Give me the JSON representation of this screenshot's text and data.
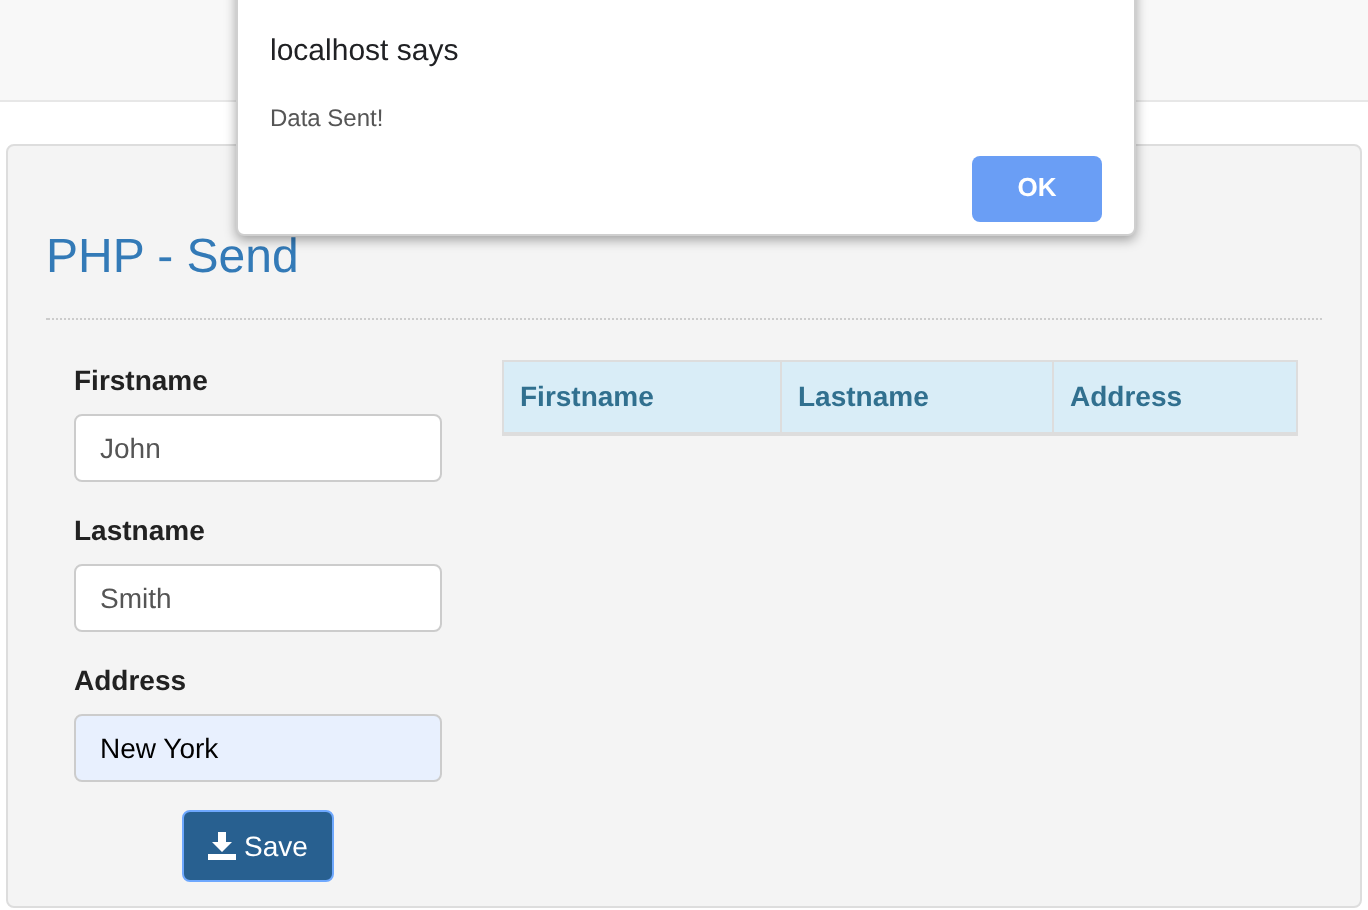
{
  "page": {
    "title": "PHP - Send"
  },
  "form": {
    "fields": [
      {
        "label": "Firstname",
        "value": "John",
        "highlighted": false
      },
      {
        "label": "Lastname",
        "value": "Smith",
        "highlighted": false
      },
      {
        "label": "Address",
        "value": "New York",
        "highlighted": true
      }
    ],
    "button": "Save"
  },
  "table": {
    "columns": [
      "Firstname",
      "Lastname",
      "Address"
    ]
  },
  "dialog": {
    "title": "localhost says",
    "message": "Data Sent!",
    "button": "OK"
  }
}
